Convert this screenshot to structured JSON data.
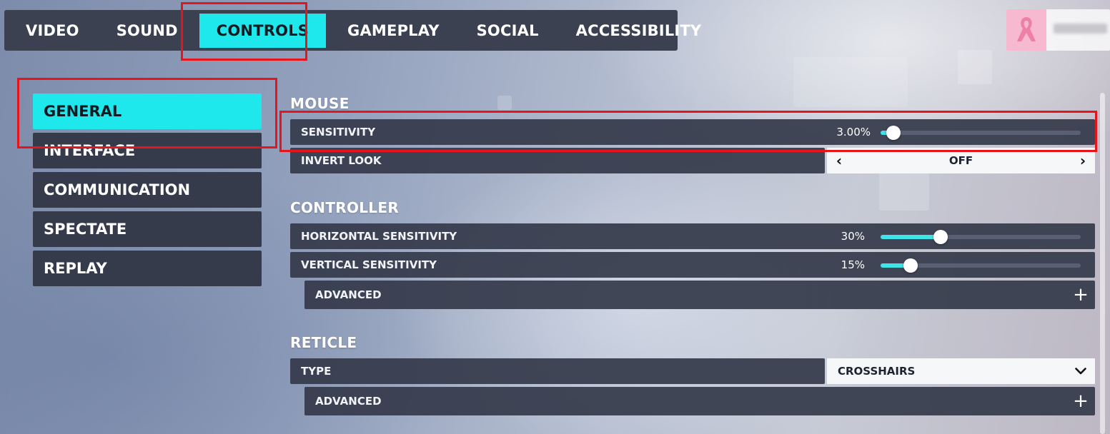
{
  "top_tabs": [
    {
      "label": "VIDEO",
      "active": false
    },
    {
      "label": "SOUND",
      "active": false
    },
    {
      "label": "CONTROLS",
      "active": true
    },
    {
      "label": "GAMEPLAY",
      "active": false
    },
    {
      "label": "SOCIAL",
      "active": false
    },
    {
      "label": "ACCESSIBILITY",
      "active": false
    }
  ],
  "sidebar": {
    "items": [
      {
        "label": "GENERAL",
        "active": true
      },
      {
        "label": "INTERFACE",
        "active": false
      },
      {
        "label": "COMMUNICATION",
        "active": false
      },
      {
        "label": "SPECTATE",
        "active": false
      },
      {
        "label": "REPLAY",
        "active": false
      }
    ]
  },
  "mouse": {
    "title": "MOUSE",
    "sensitivity": {
      "label": "SENSITIVITY",
      "value_text": "3.00%",
      "level": 0.03
    },
    "invert_look": {
      "label": "INVERT LOOK",
      "value": "OFF"
    }
  },
  "controller": {
    "title": "CONTROLLER",
    "horizontal": {
      "label": "HORIZONTAL SENSITIVITY",
      "value_text": "30%",
      "level": 0.3
    },
    "vertical": {
      "label": "VERTICAL SENSITIVITY",
      "value_text": "15%",
      "level": 0.15
    },
    "advanced_label": "ADVANCED"
  },
  "reticle": {
    "title": "RETICLE",
    "type": {
      "label": "TYPE",
      "value": "CROSSHAIRS"
    },
    "advanced_label": "ADVANCED"
  },
  "colors": {
    "accent": "#1ee8ec",
    "panel": "#353b4b",
    "highlight": "#e8141b"
  },
  "icons": {
    "selector_prev": "‹",
    "selector_next": "›",
    "dropdown": "chevron-down-icon",
    "expand": "+"
  }
}
